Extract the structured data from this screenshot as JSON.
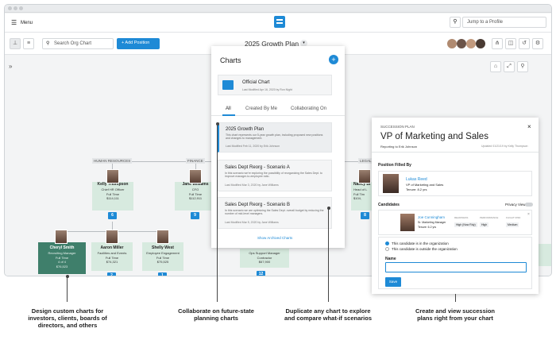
{
  "topbar": {
    "menu_label": "Menu",
    "jump_placeholder": "Jump to a Profile"
  },
  "toolbar": {
    "search_placeholder": "Search Org Chart",
    "add_position_label": "+ Add Position",
    "chart_title": "2025 Growth Plan"
  },
  "departments": [
    "HUMAN RESOURCES",
    "FINANCE",
    "LEGAL"
  ],
  "org": {
    "kelly": {
      "name": "Kelly Thompson",
      "title": "Chief HR Officer",
      "type": "Full Time",
      "salary": "$114,111",
      "count": "6"
    },
    "jane": {
      "name": "Jane Williams",
      "title": "CFO",
      "type": "Full Time",
      "salary": "$112,911",
      "count": "9"
    },
    "nancy": {
      "name": "Nancy Bl",
      "title": "Head of L",
      "type": "Full Tim",
      "salary": "$104,",
      "count": "8"
    },
    "cheryl": {
      "name": "Cheryl Smith",
      "title": "Recruiting Manager",
      "type": "Full Time",
      "salary": "4 of 4",
      "extra": "$76,523"
    },
    "aaron": {
      "name": "Aaron Miller",
      "title": "Facilities and Events",
      "type": "Full Time",
      "salary": "$74,321",
      "count": "2"
    },
    "shelly": {
      "name": "Shelly West",
      "title": "Employee Engagement",
      "type": "Full Time",
      "salary": "$75,525",
      "count": "1"
    },
    "ops": {
      "title": "Ops Support Manager",
      "type": "Contractor",
      "salary": "$67,900",
      "count": "12"
    }
  },
  "charts_panel": {
    "title": "Charts",
    "official": {
      "name": "Official Chart",
      "meta": "Last Modified Apr 16, 2020 by Ron Night"
    },
    "tabs": [
      "All",
      "Created By Me",
      "Collaborating On"
    ],
    "items": [
      {
        "name": "2025 Growth Plan",
        "desc": "This chart represents our 5-year growth plan, including proposed new positions and changes to management.",
        "meta": "Last Modified Feb 11, 2020 by Erik Johnson"
      },
      {
        "name": "Sales Dept Reorg - Scenario A",
        "desc": "In this scenario we're exploring the possibility of reorganizing the Sales Dept. to improve manager-to-employee ratio.",
        "meta": "Last Modified Mar 3, 2020 by Jane Williams"
      },
      {
        "name": "Sales Dept Reorg - Scenario B",
        "desc": "In this scenario we are optimizing the Sales Dept. overall budget by reducing the number of mid-level managers.",
        "meta": "Last Modified Mar 5, 2020 by Jane Williams"
      }
    ],
    "show_archived": "Show Archived Charts"
  },
  "succession": {
    "label": "SUCCESSION PLAN",
    "title": "VP of Marketing and Sales",
    "reporting": "Reporting to Erik Johnson",
    "updated": "Updated 01/21/19 by Kelly Thompson",
    "filled_label": "Position Filled By",
    "holder": {
      "name": "Lukas Reed",
      "title": "VP of Marketing and Sales",
      "tenure": "Tenure: 8.2 yrs"
    },
    "candidates_label": "Candidates",
    "privacy_label": "Privacy View",
    "candidate": {
      "name": "Joe Cunningham",
      "title": "Sr. Marketing Manager",
      "tenure": "Tenure: 6.2 yrs",
      "cols": [
        "READINESS",
        "PERFORMANCE",
        "FLIGHT RISK"
      ],
      "vals": [
        "High (Now Rdy)",
        "High",
        "Medium"
      ]
    },
    "option_in": "This candidate is in the organization",
    "option_out": "This candidate is outside the organization",
    "name_label": "Name",
    "save_label": "Save"
  },
  "captions": [
    "Design custom charts for investors, clients, boards of directors, and others",
    "Collaborate on future-state planning charts",
    "Duplicate any chart to explore and compare what-if scenarios",
    "Create and view succession plans right from your chart"
  ],
  "colors": {
    "accent": "#1e8ad6",
    "card": "#d7eadf",
    "card_dark": "#3f7f6b"
  }
}
